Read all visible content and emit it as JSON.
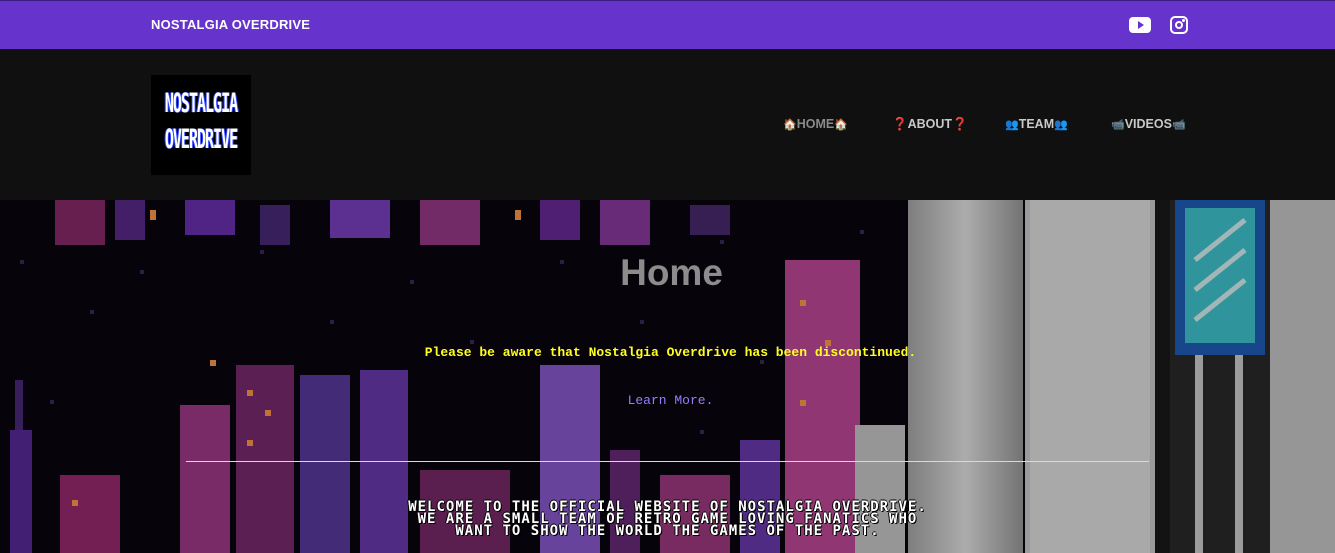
{
  "topbar": {
    "site_name": "NOSTALGIA OVERDRIVE",
    "social": [
      {
        "icon": "youtube-icon"
      },
      {
        "icon": "instagram-icon"
      }
    ],
    "background": "#6633cc"
  },
  "header": {
    "logo": {
      "line1": "NOSTALGIA",
      "line2": "OVERDRIVE"
    },
    "nav": [
      {
        "emoji": "🏠",
        "label": "HOME",
        "active": true
      },
      {
        "emoji": "❓",
        "label": "ABOUT",
        "active": false
      },
      {
        "emoji": "👥",
        "label": "TEAM",
        "active": false
      },
      {
        "emoji": "📹",
        "label": "VIDEOS",
        "active": false
      }
    ]
  },
  "hero": {
    "title": "Home",
    "notice": "Please be aware that Nostalgia Overdrive has been discontinued.",
    "link": "Learn More.",
    "welcome_line1": "Welcome to the official website of Nostalgia Overdrive.",
    "welcome_line2": "We are a small team of retro game loving fanatics who",
    "welcome_line3": "want to show the world the games of the past."
  },
  "colors": {
    "notice": "#ffff22",
    "link": "#9b7cff",
    "header_bg": "#101010"
  }
}
